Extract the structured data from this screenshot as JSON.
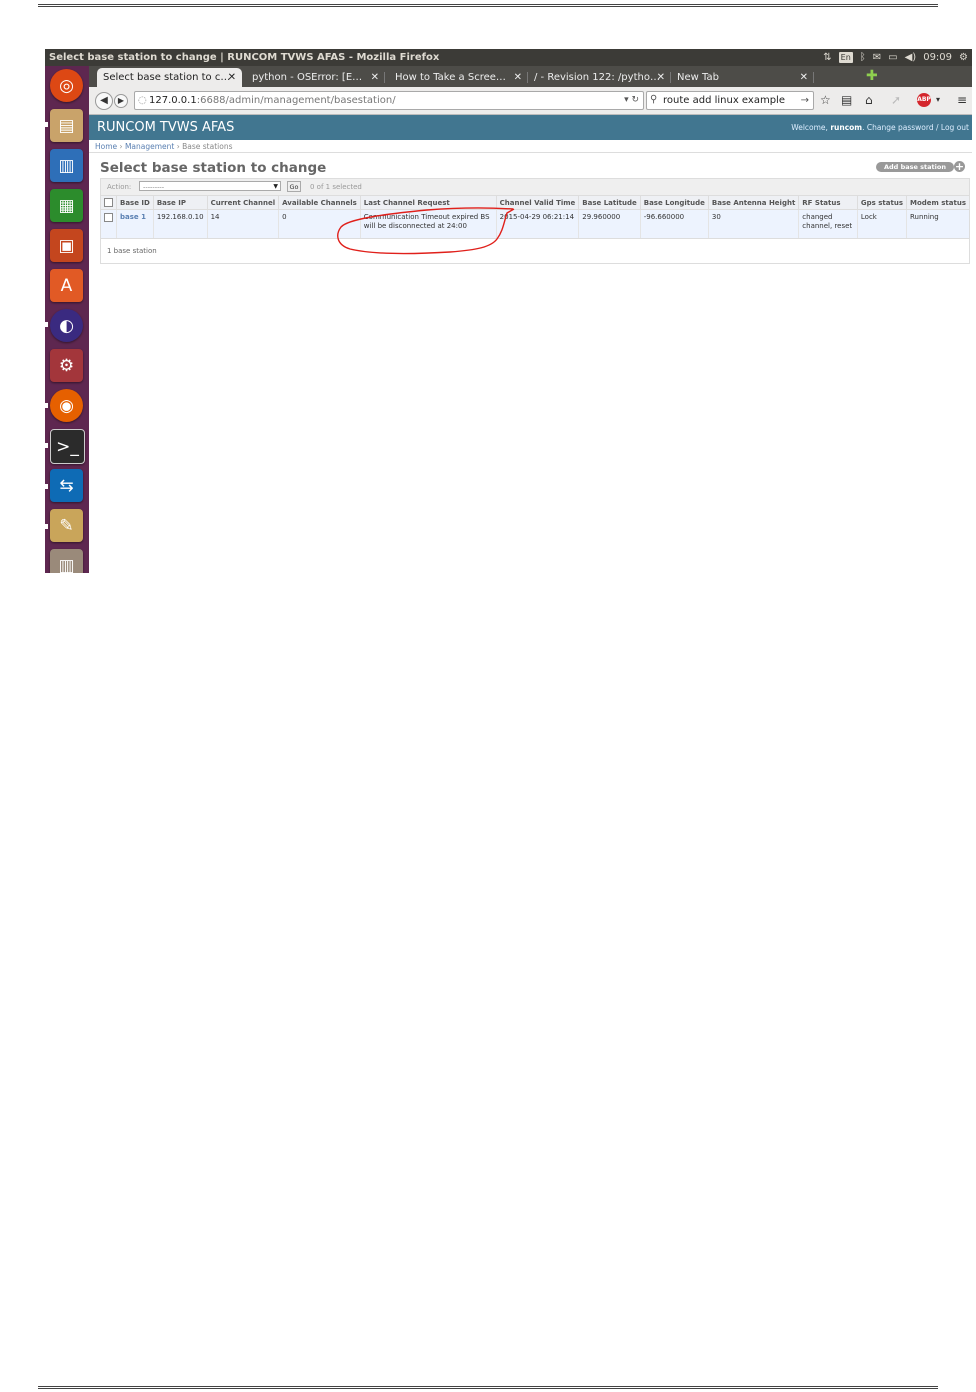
{
  "window_title": "Select base station to change | RUNCOM TVWS AFAS - Mozilla Firefox",
  "system_tray": {
    "lang": "En",
    "time": "09:09"
  },
  "tabs": [
    {
      "label": "Select base station to c…",
      "active": true
    },
    {
      "label": "python - OSError: [E…",
      "active": false
    },
    {
      "label": "How to Take a Scree…",
      "active": false
    },
    {
      "label": "/ - Revision 122: /pytho…",
      "active": false
    },
    {
      "label": "New Tab",
      "active": false
    }
  ],
  "url": {
    "host": "127.0.0.1",
    "rest": ":6688/admin/management/basestation/"
  },
  "search": {
    "value": "route add linux example"
  },
  "admin": {
    "brand": "RUNCOM TVWS AFAS",
    "welcome": "Welcome,",
    "user": "runcom",
    "change_password": "Change password",
    "log_out": "Log out",
    "breadcrumbs": {
      "home": "Home",
      "management": "Management",
      "current": "Base stations"
    },
    "title": "Select base station to change",
    "add_button": "Add base station",
    "action_label": "Action:",
    "action_value": "---------",
    "go_label": "Go",
    "selected_counter": "0 of 1 selected",
    "columns": [
      "Base ID",
      "Base IP",
      "Current Channel",
      "Available Channels",
      "Last Channel Request",
      "Channel Valid Time",
      "Base Latitude",
      "Base Longitude",
      "Base Antenna Height",
      "RF Status",
      "Gps status",
      "Modem status"
    ],
    "rows": [
      {
        "base_id": "base 1",
        "base_ip": "192.168.0.10",
        "current_channel": "14",
        "available_channels": "0",
        "last_channel_request": "Communication Timeout expired BS will be disconnected at 24:00",
        "channel_valid_time": "2015-04-29 06:21:14",
        "base_latitude": "29.960000",
        "base_longitude": "-96.660000",
        "base_antenna_height": "30",
        "rf_status": "changed channel, reset",
        "gps_status": "Lock",
        "modem_status": "Running"
      }
    ],
    "paginator": "1 base station"
  },
  "colors": {
    "admin_header": "#417690",
    "launcher": "#5e2750",
    "annotation": "#e0201b"
  }
}
